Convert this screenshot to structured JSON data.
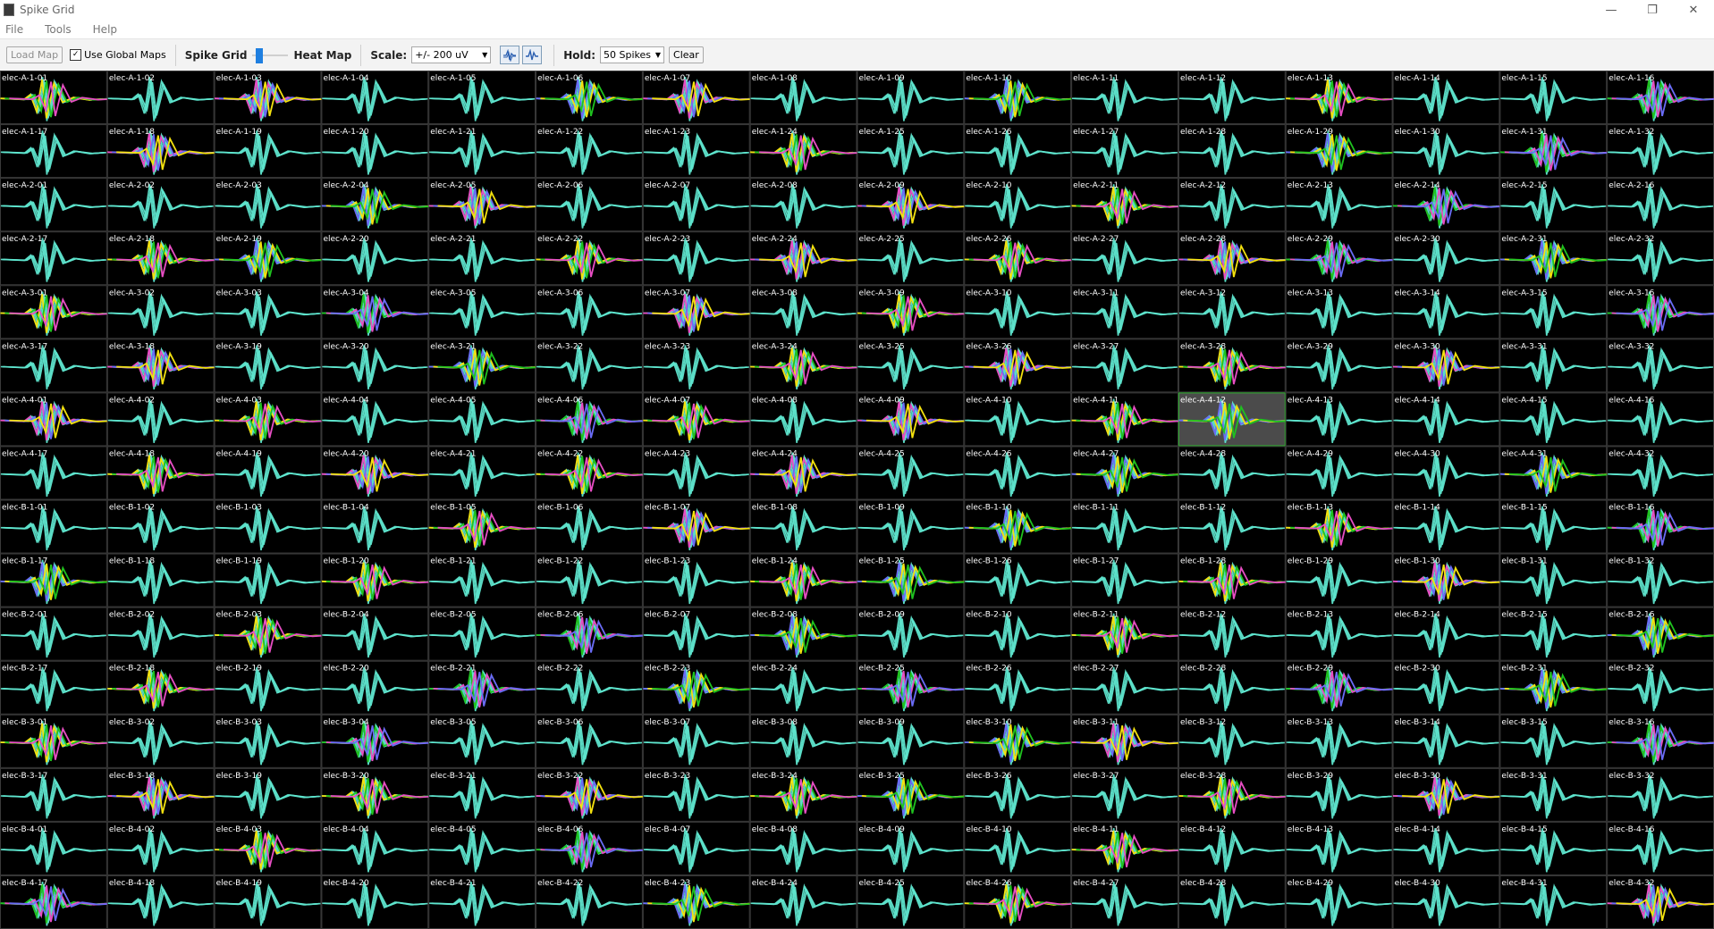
{
  "window": {
    "title": "Spike Grid",
    "minimize_glyph": "—",
    "restore_glyph": "❐",
    "close_glyph": "✕"
  },
  "menu": [
    "File",
    "Tools",
    "Help"
  ],
  "toolbar": {
    "load_map_label": "Load Map",
    "use_global_maps_label": "Use Global Maps",
    "use_global_maps_checked": true,
    "check_glyph": "✓",
    "spike_grid_label": "Spike Grid",
    "heat_map_label": "Heat Map",
    "scale_label": "Scale:",
    "scale_value": "+/- 200 uV",
    "hold_label": "Hold:",
    "hold_value": "50 Spikes",
    "clear_label": "Clear",
    "icons": [
      "overlay-waveforms-icon",
      "single-waveform-icon"
    ]
  },
  "colors": {
    "background": "#000000",
    "grid_line": "#3a3a3a",
    "base_wave": "#5fe6cf",
    "unit_colors": [
      "#f4e20f",
      "#1fc21f",
      "#e84ec4",
      "#6a6cf6"
    ],
    "selected_fill": "#4b4b4b",
    "selected_border": "#2fb12f",
    "label": "#ffffff"
  },
  "grid": {
    "rows": [
      {
        "labels": [
          "elec-A-1-01",
          "elec-A-1-02",
          "elec-A-1-03",
          "elec-A-1-04",
          "elec-A-1-05",
          "elec-A-1-06",
          "elec-A-1-07",
          "elec-A-1-08",
          "elec-A-1-09",
          "elec-A-1-10",
          "elec-A-1-11",
          "elec-A-1-12",
          "elec-A-1-13",
          "elec-A-1-14",
          "elec-A-1-15",
          "elec-A-1-16"
        ]
      },
      {
        "labels": [
          "elec-A-1-17",
          "elec-A-1-18",
          "elec-A-1-19",
          "elec-A-1-20",
          "elec-A-1-21",
          "elec-A-1-22",
          "elec-A-1-23",
          "elec-A-1-24",
          "elec-A-1-25",
          "elec-A-1-26",
          "elec-A-1-27",
          "elec-A-1-28",
          "elec-A-1-29",
          "elec-A-1-30",
          "elec-A-1-31",
          "elec-A-1-32"
        ]
      },
      {
        "labels": [
          "elec-A-2-01",
          "elec-A-2-02",
          "elec-A-2-03",
          "elec-A-2-04",
          "elec-A-2-05",
          "elec-A-2-06",
          "elec-A-2-07",
          "elec-A-2-08",
          "elec-A-2-09",
          "elec-A-2-10",
          "elec-A-2-11",
          "elec-A-2-12",
          "elec-A-2-13",
          "elec-A-2-14",
          "elec-A-2-15",
          "elec-A-2-16"
        ]
      },
      {
        "labels": [
          "elec-A-2-17",
          "elec-A-2-18",
          "elec-A-2-19",
          "elec-A-2-20",
          "elec-A-2-21",
          "elec-A-2-22",
          "elec-A-2-23",
          "elec-A-2-24",
          "elec-A-2-25",
          "elec-A-2-26",
          "elec-A-2-27",
          "elec-A-2-28",
          "elec-A-2-29",
          "elec-A-2-30",
          "elec-A-2-31",
          "elec-A-2-32"
        ]
      },
      {
        "labels": [
          "elec-A-3-01",
          "elec-A-3-02",
          "elec-A-3-03",
          "elec-A-3-04",
          "elec-A-3-05",
          "elec-A-3-06",
          "elec-A-3-07",
          "elec-A-3-08",
          "elec-A-3-09",
          "elec-A-3-10",
          "elec-A-3-11",
          "elec-A-3-12",
          "elec-A-3-13",
          "elec-A-3-14",
          "elec-A-3-15",
          "elec-A-3-16"
        ]
      },
      {
        "labels": [
          "elec-A-3-17",
          "elec-A-3-18",
          "elec-A-3-19",
          "elec-A-3-20",
          "elec-A-3-21",
          "elec-A-3-22",
          "elec-A-3-23",
          "elec-A-3-24",
          "elec-A-3-25",
          "elec-A-3-26",
          "elec-A-3-27",
          "elec-A-3-28",
          "elec-A-3-29",
          "elec-A-3-30",
          "elec-A-3-31",
          "elec-A-3-32"
        ]
      },
      {
        "labels": [
          "elec-A-4-01",
          "elec-A-4-02",
          "elec-A-4-03",
          "elec-A-4-04",
          "elec-A-4-05",
          "elec-A-4-06",
          "elec-A-4-07",
          "elec-A-4-08",
          "elec-A-4-09",
          "elec-A-4-10",
          "elec-A-4-11",
          "elec-A-4-12",
          "elec-A-4-13",
          "elec-A-4-14",
          "elec-A-4-15",
          "elec-A-4-16"
        ]
      },
      {
        "labels": [
          "elec-A-4-17",
          "elec-A-4-18",
          "elec-A-4-19",
          "elec-A-4-20",
          "elec-A-4-21",
          "elec-A-4-22",
          "elec-A-4-23",
          "elec-A-4-24",
          "elec-A-4-25",
          "elec-A-4-26",
          "elec-A-4-27",
          "elec-A-4-28",
          "elec-A-4-29",
          "elec-A-4-30",
          "elec-A-4-31",
          "elec-A-4-32"
        ]
      },
      {
        "labels": [
          "elec-B-1-01",
          "elec-B-1-02",
          "elec-B-1-03",
          "elec-B-1-04",
          "elec-B-1-05",
          "elec-B-1-06",
          "elec-B-1-07",
          "elec-B-1-08",
          "elec-B-1-09",
          "elec-B-1-10",
          "elec-B-1-11",
          "elec-B-1-12",
          "elec-B-1-13",
          "elec-B-1-14",
          "elec-B-1-15",
          "elec-B-1-16"
        ]
      },
      {
        "labels": [
          "elec-B-1-17",
          "elec-B-1-18",
          "elec-B-1-19",
          "elec-B-1-20",
          "elec-B-1-21",
          "elec-B-1-22",
          "elec-B-1-23",
          "elec-B-1-24",
          "elec-B-1-25",
          "elec-B-1-26",
          "elec-B-1-27",
          "elec-B-1-28",
          "elec-B-1-29",
          "elec-B-1-30",
          "elec-B-1-31",
          "elec-B-1-32"
        ]
      },
      {
        "labels": [
          "elec-B-2-01",
          "elec-B-2-02",
          "elec-B-2-03",
          "elec-B-2-04",
          "elec-B-2-05",
          "elec-B-2-06",
          "elec-B-2-07",
          "elec-B-2-08",
          "elec-B-2-09",
          "elec-B-2-10",
          "elec-B-2-11",
          "elec-B-2-12",
          "elec-B-2-13",
          "elec-B-2-14",
          "elec-B-2-15",
          "elec-B-2-16"
        ]
      },
      {
        "labels": [
          "elec-B-2-17",
          "elec-B-2-18",
          "elec-B-2-19",
          "elec-B-2-20",
          "elec-B-2-21",
          "elec-B-2-22",
          "elec-B-2-23",
          "elec-B-2-24",
          "elec-B-2-25",
          "elec-B-2-26",
          "elec-B-2-27",
          "elec-B-2-28",
          "elec-B-2-29",
          "elec-B-2-30",
          "elec-B-2-31",
          "elec-B-2-32"
        ]
      },
      {
        "labels": [
          "elec-B-3-01",
          "elec-B-3-02",
          "elec-B-3-03",
          "elec-B-3-04",
          "elec-B-3-05",
          "elec-B-3-06",
          "elec-B-3-07",
          "elec-B-3-08",
          "elec-B-3-09",
          "elec-B-3-10",
          "elec-B-3-11",
          "elec-B-3-12",
          "elec-B-3-13",
          "elec-B-3-14",
          "elec-B-3-15",
          "elec-B-3-16"
        ]
      },
      {
        "labels": [
          "elec-B-3-17",
          "elec-B-3-18",
          "elec-B-3-19",
          "elec-B-3-20",
          "elec-B-3-21",
          "elec-B-3-22",
          "elec-B-3-23",
          "elec-B-3-24",
          "elec-B-3-25",
          "elec-B-3-26",
          "elec-B-3-27",
          "elec-B-3-28",
          "elec-B-3-29",
          "elec-B-3-30",
          "elec-B-3-31",
          "elec-B-3-32"
        ]
      },
      {
        "labels": [
          "elec-B-4-01",
          "elec-B-4-02",
          "elec-B-4-03",
          "elec-B-4-04",
          "elec-B-4-05",
          "elec-B-4-06",
          "elec-B-4-07",
          "elec-B-4-08",
          "elec-B-4-09",
          "elec-B-4-10",
          "elec-B-4-11",
          "elec-B-4-12",
          "elec-B-4-13",
          "elec-B-4-14",
          "elec-B-4-15",
          "elec-B-4-16"
        ]
      },
      {
        "labels": [
          "elec-B-4-17",
          "elec-B-4-18",
          "elec-B-4-19",
          "elec-B-4-20",
          "elec-B-4-21",
          "elec-B-4-22",
          "elec-B-4-23",
          "elec-B-4-24",
          "elec-B-4-25",
          "elec-B-4-26",
          "elec-B-4-27",
          "elec-B-4-28",
          "elec-B-4-29",
          "elec-B-4-30",
          "elec-B-4-31",
          "elec-B-4-32"
        ]
      }
    ],
    "selected_cell": "elec-A-4-12",
    "colored_cells": {
      "0": [
        0,
        2,
        5,
        6,
        9,
        12,
        15
      ],
      "1": [
        1,
        7,
        12,
        14
      ],
      "2": [
        3,
        4,
        8,
        10,
        13
      ],
      "3": [
        1,
        2,
        5,
        7,
        9,
        11,
        12,
        14
      ],
      "4": [
        0,
        3,
        6,
        8,
        15
      ],
      "5": [
        1,
        4,
        7,
        9,
        11,
        13
      ],
      "6": [
        0,
        2,
        5,
        6,
        8,
        10,
        11
      ],
      "7": [
        1,
        3,
        5,
        7,
        10,
        14
      ],
      "8": [
        4,
        6,
        9,
        12,
        15
      ],
      "9": [
        0,
        3,
        7,
        8,
        11,
        13
      ],
      "10": [
        2,
        5,
        7,
        10,
        15
      ],
      "11": [
        1,
        4,
        6,
        8,
        12,
        14
      ],
      "12": [
        0,
        3,
        9,
        10,
        15
      ],
      "13": [
        1,
        3,
        5,
        7,
        8,
        11,
        13
      ],
      "14": [
        2,
        5,
        10
      ],
      "15": [
        0,
        6,
        9,
        15
      ]
    }
  }
}
